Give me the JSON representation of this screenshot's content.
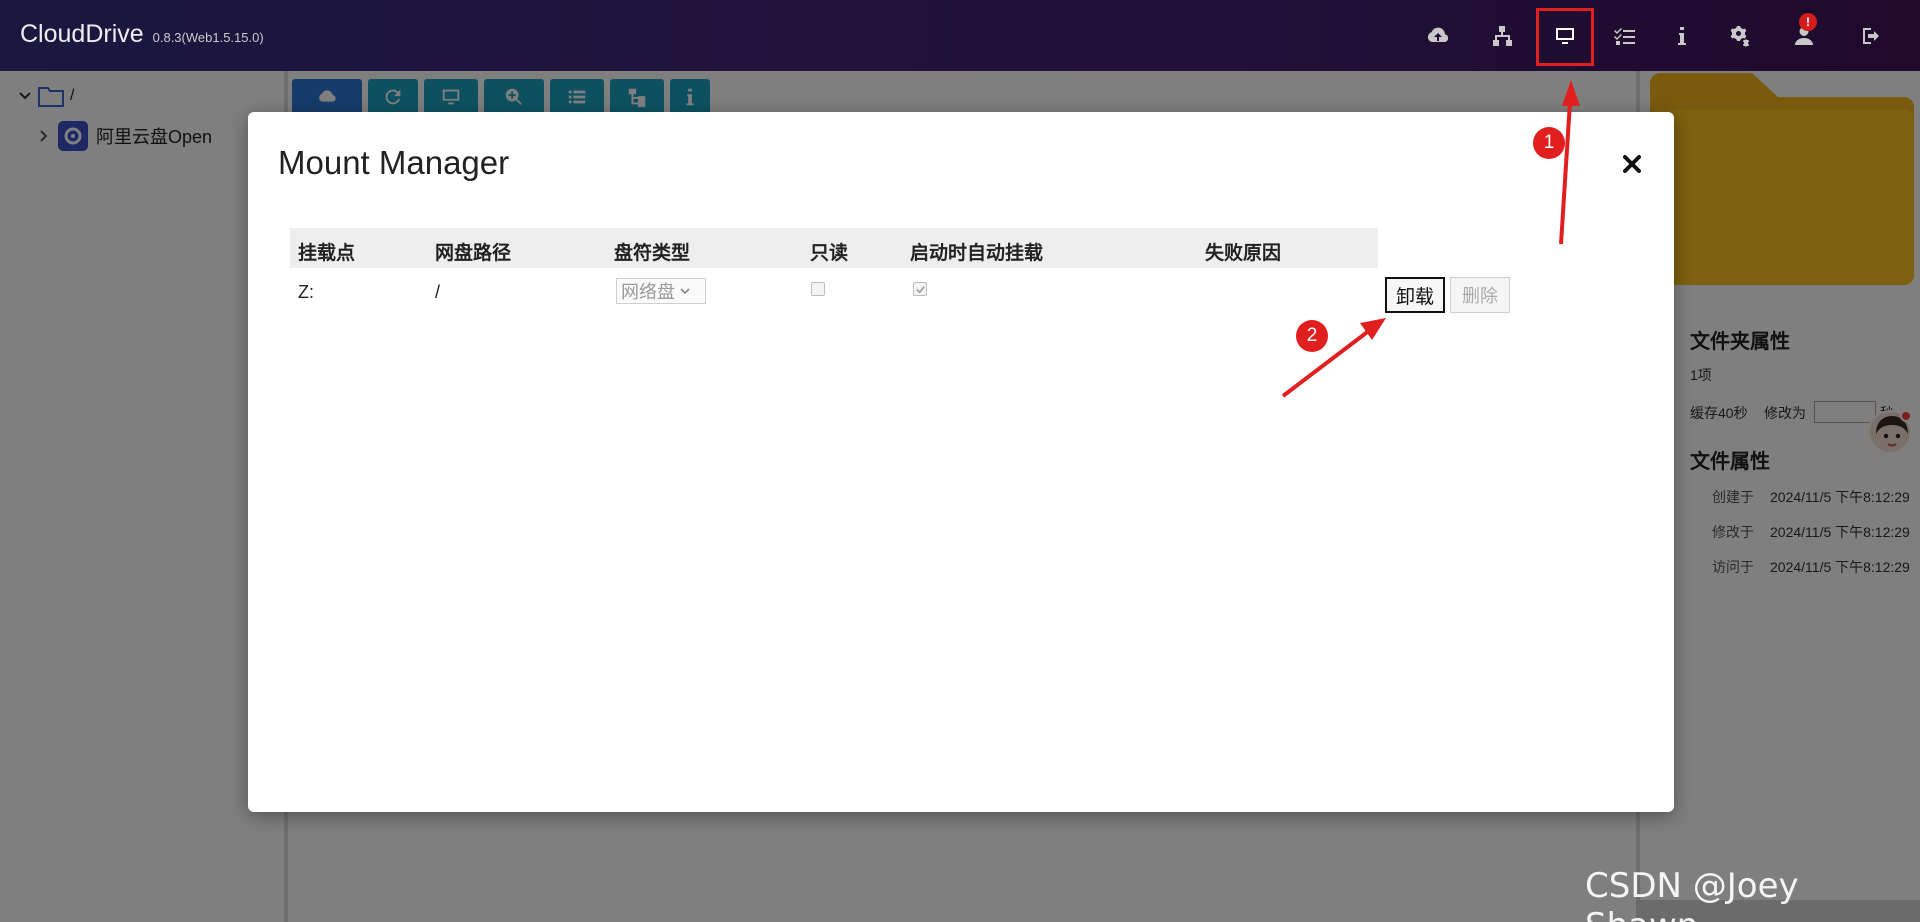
{
  "app": {
    "brand": "CloudDrive",
    "version": "0.8.3(Web1.5.15.0)",
    "nav_icons": [
      "cloud-upload-icon",
      "network-icon",
      "monitor-icon",
      "task-list-icon",
      "info-icon",
      "settings-icon",
      "user-icon",
      "logout-icon"
    ],
    "user_badge": "!"
  },
  "tree": {
    "root_label": "/",
    "items": [
      {
        "label": "阿里云盘Open"
      }
    ]
  },
  "right_panel": {
    "folder_section_title": "文件夹属性",
    "item_count": "1项",
    "cache_label": "缓存40秒",
    "modify_label": "修改为",
    "seconds_label": "秒",
    "file_section_title": "文件属性",
    "created_label": "创建于",
    "created_value": "2024/11/5 下午8:12:29",
    "modified_label": "修改于",
    "modified_value": "2024/11/5 下午8:12:29",
    "accessed_label": "访问于",
    "accessed_value": "2024/11/5 下午8:12:29"
  },
  "modal": {
    "title": "Mount Manager",
    "columns": [
      "挂载点",
      "网盘路径",
      "盘符类型",
      "只读",
      "启动时自动挂载",
      "失败原因"
    ],
    "rows": [
      {
        "mount_point": "Z:",
        "path": "/",
        "drive_type": "网络盘",
        "read_only": false,
        "auto_mount": true,
        "failure_reason": ""
      }
    ],
    "unmount_label": "卸载",
    "delete_label": "删除"
  },
  "annotations": {
    "step1": "1",
    "step2": "2",
    "color": "#e21f1f"
  },
  "watermark": "CSDN @Joey Shawn",
  "colors": {
    "topbar": "#1f1035",
    "toolbar_teal": "#1aa2c1",
    "toolbar_blue": "#2b78d4",
    "folder_yellow": "#f5b51c"
  }
}
